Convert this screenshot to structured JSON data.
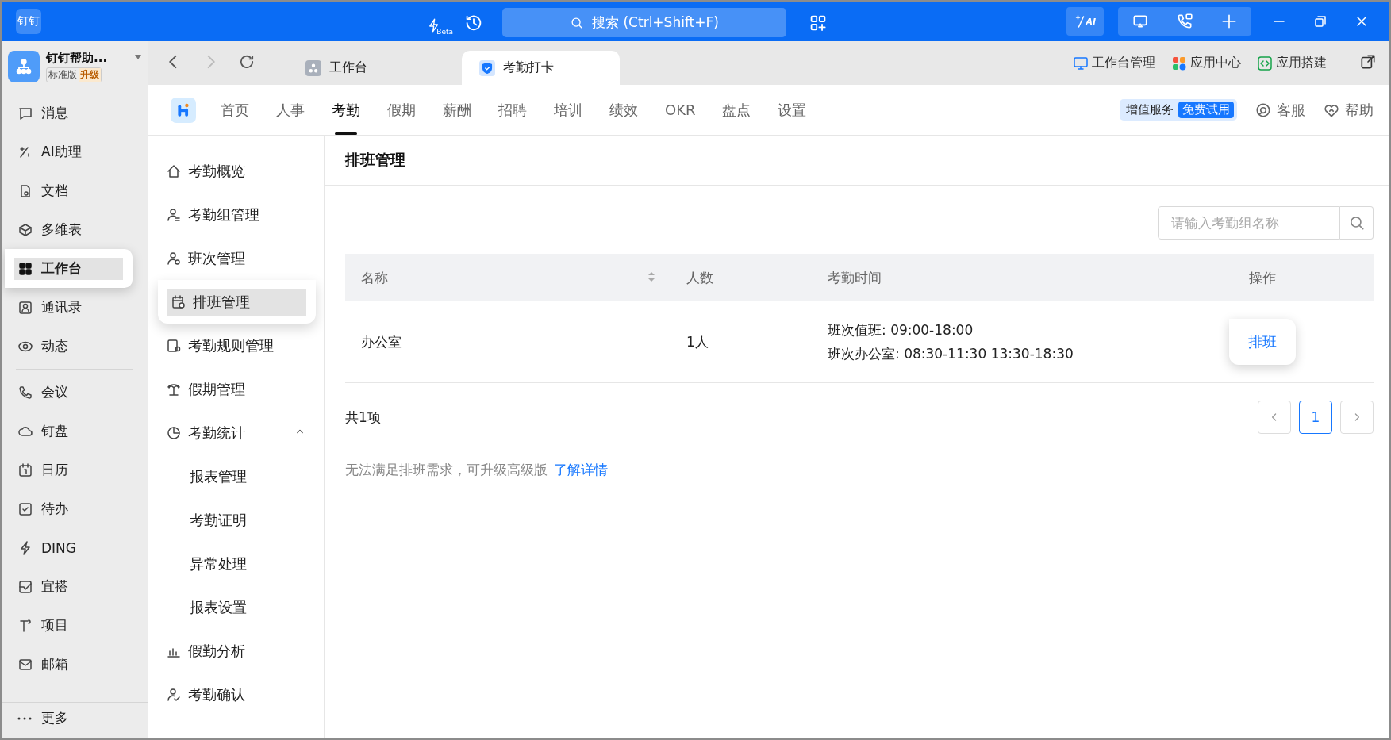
{
  "titlebar": {
    "logo": "钉钉",
    "beta": "Beta",
    "search_placeholder": "搜索 (Ctrl+Shift+F)",
    "ai": "AI"
  },
  "org": {
    "name": "钉钉帮助...",
    "edition": "标准版",
    "upgrade": "升级"
  },
  "sidebar": {
    "groups": [
      [
        {
          "label": "消息",
          "selected": false
        },
        {
          "label": "AI助理",
          "selected": false
        },
        {
          "label": "文档",
          "selected": false
        },
        {
          "label": "多维表",
          "selected": false
        },
        {
          "label": "工作台",
          "selected": true
        },
        {
          "label": "通讯录",
          "selected": false
        },
        {
          "label": "动态",
          "selected": false
        }
      ],
      [
        {
          "label": "会议",
          "selected": false
        },
        {
          "label": "钉盘",
          "selected": false
        },
        {
          "label": "日历",
          "selected": false
        },
        {
          "label": "待办",
          "selected": false
        },
        {
          "label": "DING",
          "selected": false
        },
        {
          "label": "宜搭",
          "selected": false
        },
        {
          "label": "项目",
          "selected": false
        },
        {
          "label": "邮箱",
          "selected": false
        }
      ]
    ],
    "more": "更多"
  },
  "tabs": [
    {
      "label": "工作台",
      "selected": false
    },
    {
      "label": "考勤打卡",
      "selected": true
    }
  ],
  "toolbar_links": [
    "工作台管理",
    "应用中心",
    "应用搭建"
  ],
  "app_nav": {
    "items": [
      {
        "label": "首页",
        "selected": false
      },
      {
        "label": "人事",
        "selected": false
      },
      {
        "label": "考勤",
        "selected": true
      },
      {
        "label": "假期",
        "selected": false
      },
      {
        "label": "薪酬",
        "selected": false
      },
      {
        "label": "招聘",
        "selected": false
      },
      {
        "label": "培训",
        "selected": false
      },
      {
        "label": "绩效",
        "selected": false
      },
      {
        "label": "OKR",
        "selected": false
      },
      {
        "label": "盘点",
        "selected": false
      },
      {
        "label": "设置",
        "selected": false
      }
    ],
    "value_service": {
      "label": "增值服务",
      "badge": "免费试用"
    },
    "actions": [
      "客服",
      "帮助"
    ]
  },
  "subnav": [
    {
      "label": "考勤概览",
      "selected": false
    },
    {
      "label": "考勤组管理",
      "selected": false
    },
    {
      "label": "班次管理",
      "selected": false
    },
    {
      "label": "排班管理",
      "selected": true
    },
    {
      "label": "考勤规则管理",
      "selected": false
    },
    {
      "label": "假期管理",
      "selected": false
    },
    {
      "label": "考勤统计",
      "selected": false,
      "expanded": true,
      "children": [
        {
          "label": "报表管理",
          "selected": false
        },
        {
          "label": "考勤证明",
          "selected": false
        },
        {
          "label": "异常处理",
          "selected": false
        },
        {
          "label": "报表设置",
          "selected": false
        }
      ]
    },
    {
      "label": "假勤分析",
      "selected": false
    },
    {
      "label": "考勤确认",
      "selected": false
    }
  ],
  "content": {
    "title": "排班管理",
    "search_placeholder": "请输入考勤组名称",
    "table": {
      "columns": [
        {
          "label": "名称",
          "sortable": true
        },
        {
          "label": "人数",
          "sortable": false
        },
        {
          "label": "考勤时间",
          "sortable": false
        },
        {
          "label": "操作",
          "sortable": false
        }
      ],
      "rows": [
        {
          "name": "办公室",
          "count": "1人",
          "times": [
            "班次值班: 09:00-18:00",
            "班次办公室: 08:30-11:30 13:30-18:30"
          ],
          "action": "排班"
        }
      ]
    },
    "total": "共1项",
    "pages": [
      {
        "label": "1",
        "selected": true
      }
    ],
    "notice": {
      "text": "无法满足排班需求，可升级高级版",
      "link": "了解详情"
    }
  }
}
